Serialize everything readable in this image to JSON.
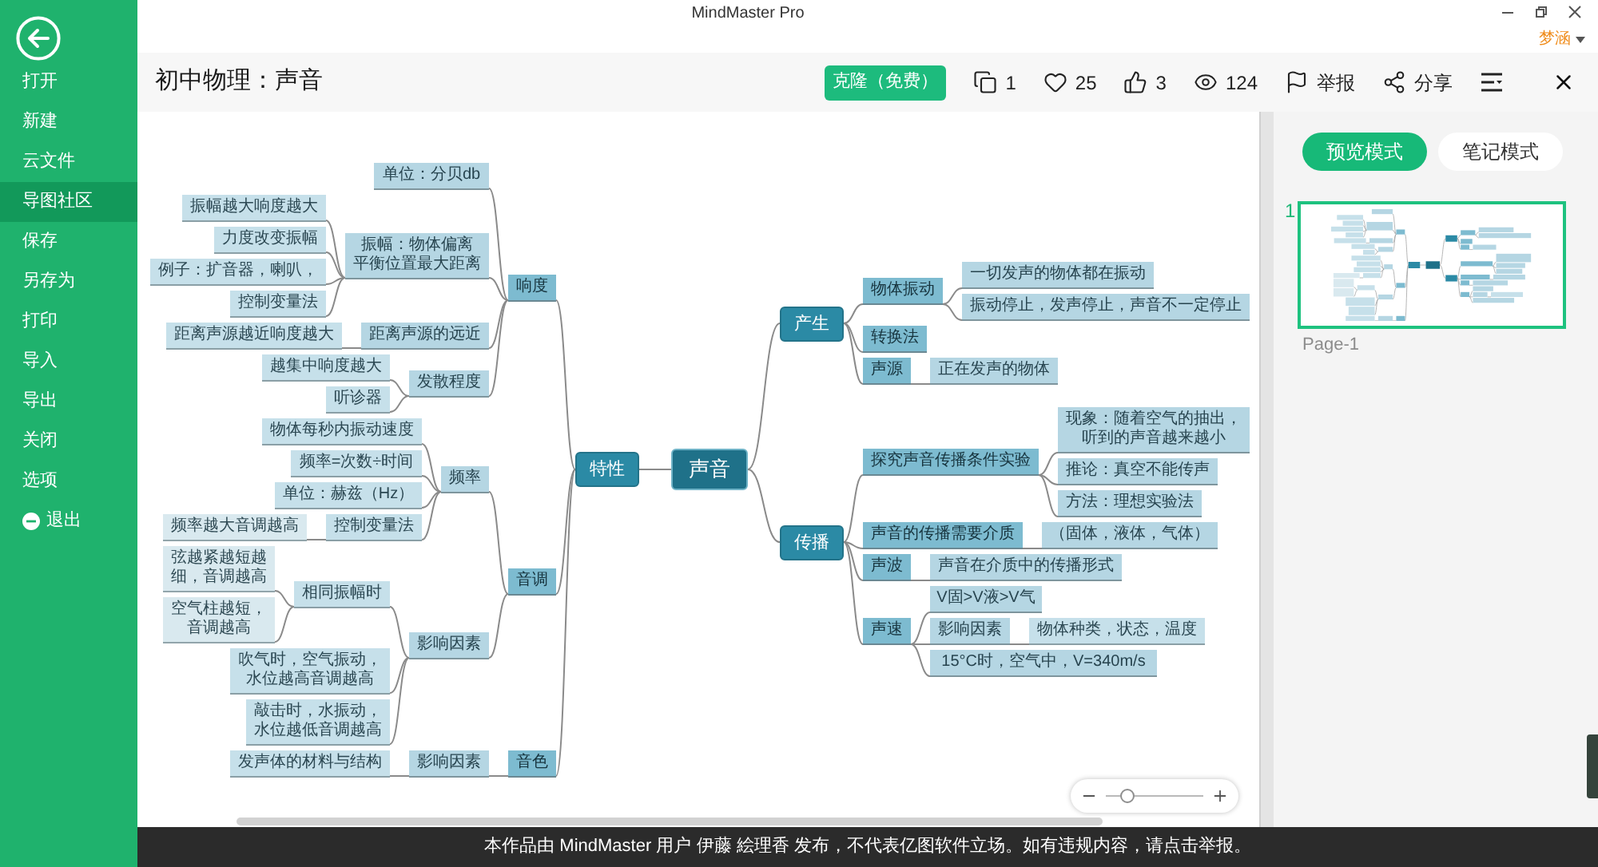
{
  "title_bar": {
    "title": "MindMaster Pro",
    "user": "梦涵"
  },
  "sidebar": {
    "items": [
      {
        "label": "打开",
        "selected": false
      },
      {
        "label": "新建",
        "selected": false
      },
      {
        "label": "云文件",
        "selected": false
      },
      {
        "label": "导图社区",
        "selected": true
      },
      {
        "label": "保存",
        "selected": false
      },
      {
        "label": "另存为",
        "selected": false
      },
      {
        "label": "打印",
        "selected": false
      },
      {
        "label": "导入",
        "selected": false
      },
      {
        "label": "导出",
        "selected": false
      },
      {
        "label": "关闭",
        "selected": false
      },
      {
        "label": "选项",
        "selected": false
      }
    ],
    "exit": {
      "label": "退出"
    }
  },
  "header": {
    "title": "初中物理：声音",
    "clone_button": "克隆（免费）",
    "stats": [
      {
        "kind": "copies",
        "value": "1"
      },
      {
        "kind": "favorites",
        "value": "25"
      },
      {
        "kind": "likes",
        "value": "3"
      },
      {
        "kind": "views",
        "value": "124"
      }
    ],
    "actions": [
      {
        "kind": "report",
        "label": "举报"
      },
      {
        "kind": "share",
        "label": "分享"
      }
    ]
  },
  "mind_map": {
    "root": "声音",
    "left": [
      {
        "text": "特性",
        "children": [
          {
            "text": "响度",
            "children": [
              {
                "text": "单位：分贝db"
              },
              {
                "text": "振幅：物体偏离平衡位置最大距离",
                "children": [
                  {
                    "text": "振幅越大响度越大"
                  },
                  {
                    "text": "力度改变振幅"
                  },
                  {
                    "text": "例子：扩音器，喇叭，"
                  },
                  {
                    "text": "控制变量法"
                  }
                ]
              },
              {
                "text": "距离声源的远近",
                "children": [
                  {
                    "text": "距离声源越近响度越大"
                  }
                ]
              },
              {
                "text": "发散程度",
                "children": [
                  {
                    "text": "越集中响度越大"
                  },
                  {
                    "text": "听诊器"
                  }
                ]
              }
            ]
          },
          {
            "text": "音调",
            "children": [
              {
                "text": "频率",
                "children": [
                  {
                    "text": "物体每秒内振动速度"
                  },
                  {
                    "text": "频率=次数÷时间"
                  },
                  {
                    "text": "单位：赫兹（Hz）"
                  },
                  {
                    "text": "控制变量法",
                    "children": [
                      {
                        "text": "频率越大音调越高"
                      }
                    ]
                  }
                ]
              },
              {
                "text": "影响因素",
                "children": [
                  {
                    "text": "相同振幅时",
                    "children": [
                      {
                        "text": "弦越紧越短越细，音调越高"
                      },
                      {
                        "text": "空气柱越短，音调越高"
                      }
                    ]
                  },
                  {
                    "text": "吹气时，空气振动，水位越高音调越高"
                  },
                  {
                    "text": "敲击时，水振动，水位越低音调越高"
                  }
                ]
              }
            ]
          },
          {
            "text": "音色",
            "children": [
              {
                "text": "影响因素",
                "children": [
                  {
                    "text": "发声体的材料与结构"
                  }
                ]
              }
            ]
          }
        ]
      }
    ],
    "right": [
      {
        "text": "产生",
        "children": [
          {
            "text": "物体振动",
            "children": [
              {
                "text": "一切发声的物体都在振动"
              },
              {
                "text": "振动停止，发声停止，声音不一定停止"
              }
            ]
          },
          {
            "text": "转换法"
          },
          {
            "text": "声源",
            "children": [
              {
                "text": "正在发声的物体"
              }
            ]
          }
        ]
      },
      {
        "text": "传播",
        "children": [
          {
            "text": "探究声音传播条件实验",
            "children": [
              {
                "text": "现象：随着空气的抽出，听到的声音越来越小"
              },
              {
                "text": "推论：真空不能传声"
              },
              {
                "text": "方法：理想实验法"
              }
            ]
          },
          {
            "text": "声音的传播需要介质",
            "children": [
              {
                "text": "（固体，液体，气体）"
              }
            ]
          },
          {
            "text": "声波",
            "children": [
              {
                "text": "声音在介质中的传播形式"
              }
            ]
          },
          {
            "text": "声速",
            "children": [
              {
                "text": "V固>V液>V气"
              },
              {
                "text": "影响因素",
                "children": [
                  {
                    "text": "物体种类，状态，温度"
                  }
                ]
              },
              {
                "text": "15°C时，空气中，V=340m/s"
              }
            ]
          }
        ]
      }
    ]
  },
  "zoom": {
    "level": 0.22
  },
  "right_panel": {
    "tabs": [
      {
        "label": "预览模式",
        "selected": true
      },
      {
        "label": "笔记模式",
        "selected": false
      }
    ],
    "pages": [
      {
        "number": "1",
        "label": "Page-1",
        "selected": true
      }
    ]
  },
  "notice": "本作品由 MindMaster 用户 伊藤 絵理香 发布，不代表亿图软件立场。如有违规内容，请点击举报。"
}
